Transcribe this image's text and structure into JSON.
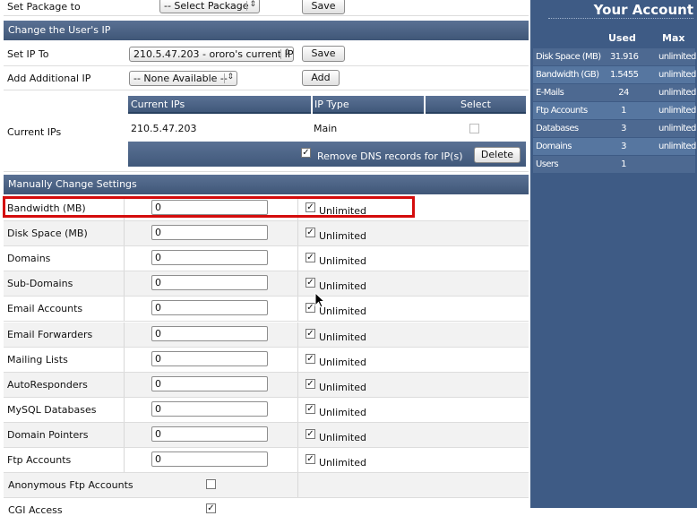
{
  "package": {
    "label": "Set Package to",
    "select": "-- Select Package",
    "button": "Save"
  },
  "ip_section": {
    "title": "Change the User's IP"
  },
  "set_ip": {
    "label": "Set IP To",
    "select": "210.5.47.203 - ororo's current IP",
    "button": "Save"
  },
  "add_ip": {
    "label": "Add Additional IP",
    "select": "-- None Available --",
    "button": "Add"
  },
  "current_ips": {
    "label": "Current IPs",
    "headers": [
      "Current IPs",
      "IP Type",
      "Select"
    ],
    "rows": [
      {
        "ip": "210.5.47.203",
        "type": "Main"
      }
    ],
    "remove_dns": "Remove DNS records for IP(s)",
    "delete_button": "Delete"
  },
  "manual": {
    "title": "Manually Change Settings",
    "unlimited_label": "Unlimited",
    "fields": [
      {
        "label": "Bandwidth (MB)",
        "value": "0"
      },
      {
        "label": "Disk Space (MB)",
        "value": "0"
      },
      {
        "label": "Domains",
        "value": "0"
      },
      {
        "label": "Sub-Domains",
        "value": "0"
      },
      {
        "label": "Email Accounts",
        "value": "0"
      },
      {
        "label": "Email Forwarders",
        "value": "0"
      },
      {
        "label": "Mailing Lists",
        "value": "0"
      },
      {
        "label": "AutoResponders",
        "value": "0"
      },
      {
        "label": "MySQL Databases",
        "value": "0"
      },
      {
        "label": "Domain Pointers",
        "value": "0"
      },
      {
        "label": "Ftp Accounts",
        "value": "0"
      }
    ],
    "anon_ftp": "Anonymous Ftp Accounts",
    "cgi": "CGI Access"
  },
  "sidebar": {
    "title": "Your Account",
    "col_used": "Used",
    "col_max": "Max",
    "rows": [
      {
        "name": "Disk Space (MB)",
        "used": "31.916",
        "max": "unlimited"
      },
      {
        "name": "Bandwidth (GB)",
        "used": "1.5455",
        "max": "unlimited"
      },
      {
        "name": "E-Mails",
        "used": "24",
        "max": "unlimited"
      },
      {
        "name": "Ftp Accounts",
        "used": "1",
        "max": "unlimited"
      },
      {
        "name": "Databases",
        "used": "3",
        "max": "unlimited"
      },
      {
        "name": "Domains",
        "used": "3",
        "max": "unlimited"
      },
      {
        "name": "Users",
        "used": "1",
        "max": ""
      }
    ]
  },
  "colors": {
    "header": "#4a6287",
    "sidebar": "#3e5b85",
    "highlight": "#d40c0c"
  }
}
